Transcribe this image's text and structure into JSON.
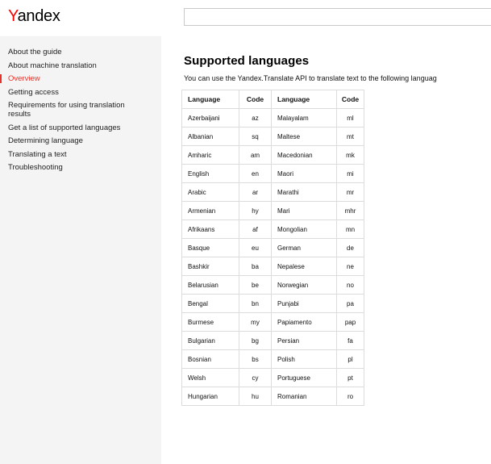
{
  "header": {
    "logo_first": "Y",
    "logo_rest": "andex",
    "search_value": "",
    "search_placeholder": ""
  },
  "sidebar": {
    "items": [
      {
        "label": "About the guide",
        "active": false
      },
      {
        "label": "About machine translation",
        "active": false
      },
      {
        "label": "Overview",
        "active": true
      },
      {
        "label": "Getting access",
        "active": false
      },
      {
        "label": "Requirements for using translation results",
        "active": false
      },
      {
        "label": "Get a list of supported languages",
        "active": false
      },
      {
        "label": "Determining language",
        "active": false
      },
      {
        "label": "Translating a text",
        "active": false
      },
      {
        "label": "Troubleshooting",
        "active": false
      }
    ]
  },
  "main": {
    "title": "Supported languages",
    "intro": "You can use the Yandex.Translate API to translate text to the following languag",
    "table": {
      "headers": [
        "Language",
        "Code",
        "Language",
        "Code"
      ],
      "rows": [
        [
          "Azerbaijani",
          "az",
          "Malayalam",
          "ml"
        ],
        [
          "Albanian",
          "sq",
          "Maltese",
          "mt"
        ],
        [
          "Amharic",
          "am",
          "Macedonian",
          "mk"
        ],
        [
          "English",
          "en",
          "Maori",
          "mi"
        ],
        [
          "Arabic",
          "ar",
          "Marathi",
          "mr"
        ],
        [
          "Armenian",
          "hy",
          "Mari",
          "mhr"
        ],
        [
          "Afrikaans",
          "af",
          "Mongolian",
          "mn"
        ],
        [
          "Basque",
          "eu",
          "German",
          "de"
        ],
        [
          "Bashkir",
          "ba",
          "Nepalese",
          "ne"
        ],
        [
          "Belarusian",
          "be",
          "Norwegian",
          "no"
        ],
        [
          "Bengal",
          "bn",
          "Punjabi",
          "pa"
        ],
        [
          "Burmese",
          "my",
          "Papiamento",
          "pap"
        ],
        [
          "Bulgarian",
          "bg",
          "Persian",
          "fa"
        ],
        [
          "Bosnian",
          "bs",
          "Polish",
          "pl"
        ],
        [
          "Welsh",
          "cy",
          "Portuguese",
          "pt"
        ],
        [
          "Hungarian",
          "hu",
          "Romanian",
          "ro"
        ]
      ]
    }
  },
  "colors": {
    "accent": "#e6332a",
    "sidebar_bg": "#f4f4f4",
    "table_border": "#dcdcdc"
  }
}
